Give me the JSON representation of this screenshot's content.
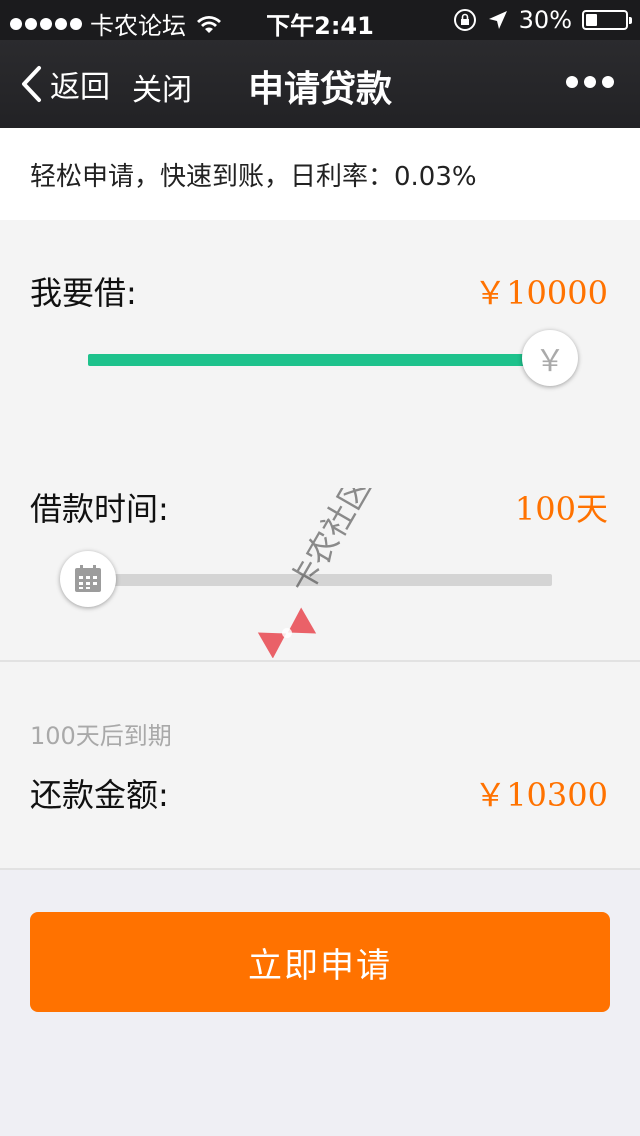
{
  "status_bar": {
    "carrier": "卡农论坛",
    "time": "下午2:41",
    "battery": "30%",
    "battery_level": 0.3
  },
  "nav": {
    "back_label": "返回",
    "close_label": "关闭",
    "title": "申请贷款"
  },
  "tagline": "轻松申请，快速到账，日利率：0.03%",
  "loan": {
    "amount_label": "我要借:",
    "amount_value": "￥10000",
    "amount_slider_fraction": 1.0,
    "amount_knob_icon": "￥",
    "amount_color": "#1ec28c"
  },
  "term": {
    "label": "借款时间:",
    "value": "100天",
    "slider_fraction": 0.0
  },
  "repay": {
    "due_text": "100天后到期",
    "label": "还款金额:",
    "value": "￥10300"
  },
  "watermark_text": "卡农社区",
  "apply_button": "立即申请",
  "colors": {
    "accent": "#ff7200",
    "slider_green": "#1ec28c",
    "track_gray": "#d4d4d4"
  }
}
